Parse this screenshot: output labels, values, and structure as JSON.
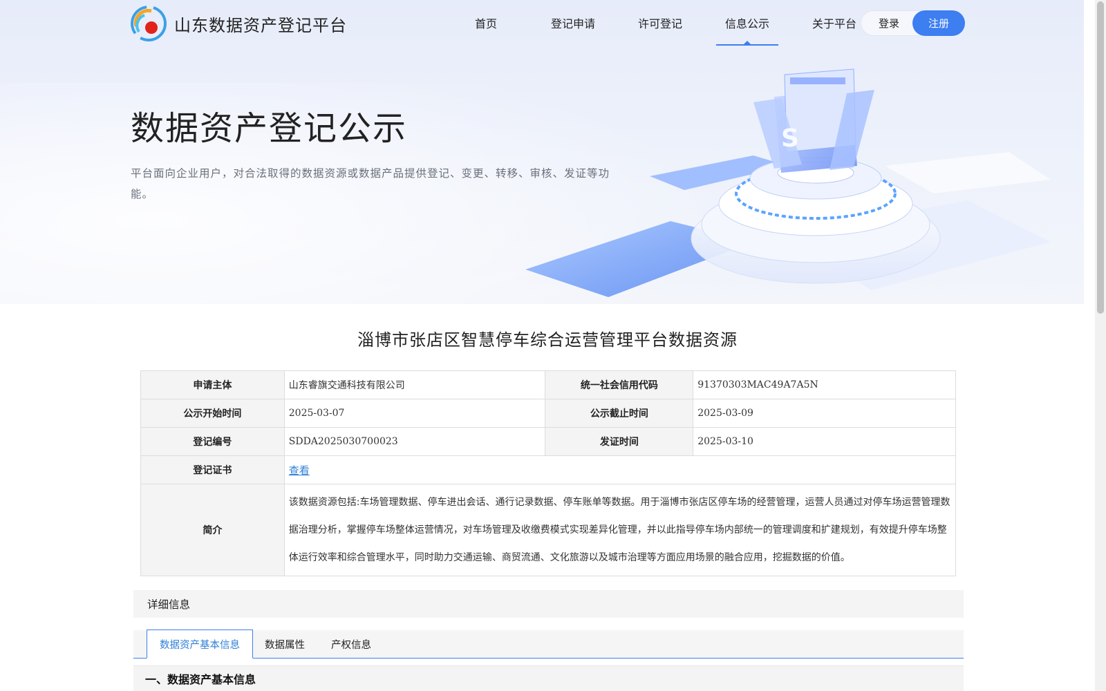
{
  "header": {
    "site_title": "山东数据资产登记平台",
    "nav": [
      "首页",
      "登记申请",
      "许可登记",
      "信息公示",
      "关于平台"
    ],
    "active_nav_index": 3,
    "login_label": "登录",
    "register_label": "注册"
  },
  "hero": {
    "title": "数据资产登记公示",
    "description": "平台面向企业用户，对合法取得的数据资源或数据产品提供登记、变更、转移、审核、发证等功能。"
  },
  "record": {
    "title": "淄博市张店区智慧停车综合运营管理平台数据资源",
    "applicant_label": "申请主体",
    "applicant": "山东睿旗交通科技有限公司",
    "credit_code_label": "统一社会信用代码",
    "credit_code": "91370303MAC49A7A5N",
    "start_label": "公示开始时间",
    "start": "2025-03-07",
    "end_label": "公示截止时间",
    "end": "2025-03-09",
    "reg_no_label": "登记编号",
    "reg_no": "SDDA2025030700023",
    "issue_label": "发证时间",
    "issue": "2025-03-10",
    "cert_label": "登记证书",
    "cert_link": "查看",
    "intro_label": "简介",
    "intro": "该数据资源包括:车场管理数据、停车进出会话、通行记录数据、停车账单等数据。用于淄博市张店区停车场的经营管理，运营人员通过对停车场运营管理数据治理分析，掌握停车场整体运营情况，对车场管理及收缴费模式实现差异化管理，并以此指导停车场内部统一的管理调度和扩建规划，有效提升停车场整体运行效率和综合管理水平，同时助力交通运输、商贸流通、文化旅游以及城市治理等方面应用场景的融合应用，挖掘数据的价值。"
  },
  "detail": {
    "bar_label": "详细信息",
    "tabs": [
      "数据资产基本信息",
      "数据属性",
      "产权信息"
    ],
    "active_tab_index": 0,
    "section_title": "一、数据资产基本信息"
  },
  "colors": {
    "accent": "#3d7ef0",
    "link": "#2f7fd6"
  }
}
